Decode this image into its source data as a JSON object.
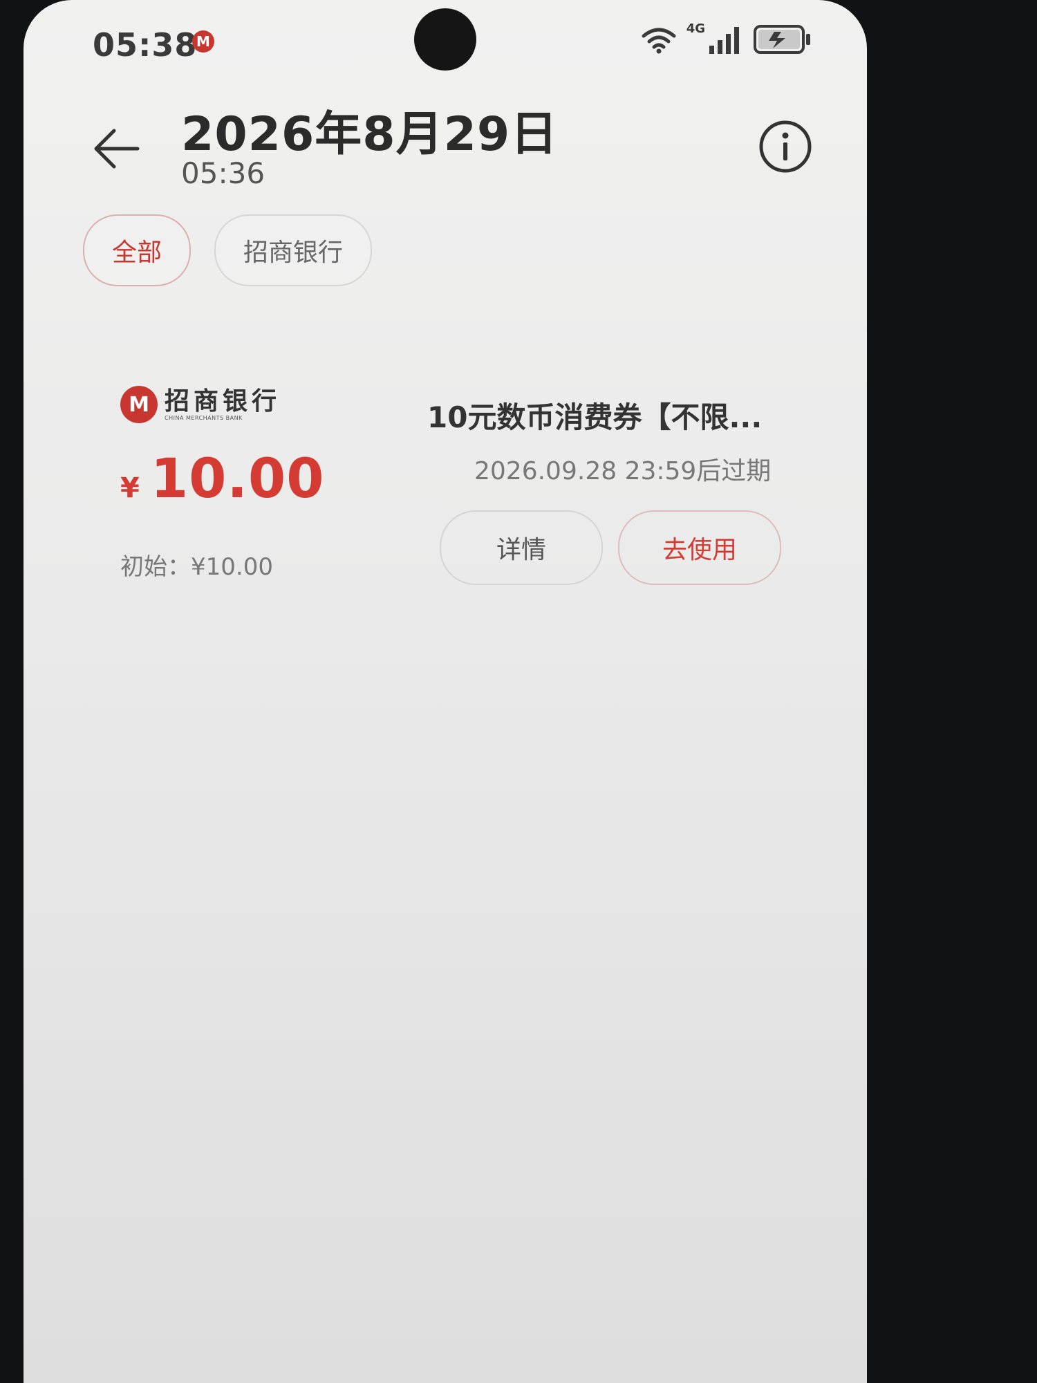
{
  "status_bar": {
    "time": "05:38",
    "app_badge": "M",
    "network": "4G",
    "icons": [
      "wifi-icon",
      "signal-icon",
      "battery-charging-icon"
    ]
  },
  "header": {
    "title": "2026年8月29日",
    "subtitle": "05:36",
    "back_icon": "arrow-left-icon",
    "info_icon": "info-circle-icon"
  },
  "filters": [
    {
      "label": "全部",
      "active": true
    },
    {
      "label": "招商银行",
      "active": false
    }
  ],
  "coupon": {
    "bank_logo_mark": "M",
    "bank_name_cn": "招商银行",
    "bank_name_en": "CHINA MERCHANTS BANK",
    "currency_symbol": "¥",
    "amount": "10.00",
    "initial_label": "初始：¥10.00",
    "title": "10元数币消费券【不限...",
    "expiry": "2026.09.28 23:59后过期",
    "detail_button": "详情",
    "use_button": "去使用"
  },
  "colors": {
    "accent": "#d43c33",
    "text_primary": "#2b2b2b",
    "text_secondary": "#777777"
  }
}
